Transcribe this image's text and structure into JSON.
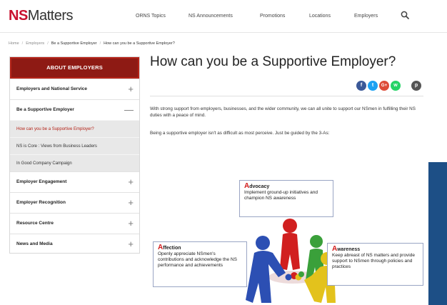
{
  "header": {
    "logo_ns": "NS",
    "logo_matters": "Matters",
    "nav": [
      "ORNS Topics",
      "NS Announcements",
      "Promotions",
      "Locations",
      "Employers"
    ]
  },
  "breadcrumb": [
    "Home",
    "Employers",
    "Be a Supportive Employer",
    "How can you be a Supportive Employer?"
  ],
  "sidebar": {
    "heading": "ABOUT EMPLOYERS",
    "items": [
      {
        "label": "Employers and National Service",
        "toggle": "+"
      },
      {
        "label": "Be a Supportive Employer",
        "toggle": "—"
      },
      {
        "label": "How can you be a Supportive Employer?"
      },
      {
        "label": "NS is Core : Views from Business Leaders"
      },
      {
        "label": "In Good Company Campaign"
      },
      {
        "label": "Employer Engagement",
        "toggle": "+"
      },
      {
        "label": "Employer Recognition",
        "toggle": "+"
      },
      {
        "label": "Resource Centre",
        "toggle": "+"
      },
      {
        "label": "News and Media",
        "toggle": "+"
      }
    ]
  },
  "main": {
    "title": "How can you be a Supportive Employer?",
    "intro": "With strong support from employers, businesses, and the wider community, we can all unite to support our NSmen in fulfilling their NS duties with a peace of mind.",
    "guide": "Being a supportive employer isn't as difficult as most perceive.  Just be guided by the 3-As:",
    "social_colors": {
      "facebook": "#3b5998",
      "twitter": "#1da1f2",
      "google": "#dd4b39",
      "whatsapp": "#25d366",
      "print": "#555555"
    },
    "social": {
      "facebook": "f",
      "twitter": "t",
      "google": "G+",
      "whatsapp": "w",
      "print": "p"
    }
  },
  "diagram": {
    "advocacy": {
      "cap": "A",
      "rest": "dvocacy",
      "text": "Implement ground-up initiatives and champion NS awareness"
    },
    "affection": {
      "cap": "A",
      "rest": "ffection",
      "text": "Openly appreciate NSmen's contributions and acknowledge the NS performance and achievements"
    },
    "awareness": {
      "cap": "A",
      "rest": "wareness",
      "text": "Keep abreast of NS matters and provide support to NSmen through policies and practices"
    },
    "figure_colors": {
      "red": "#d11f1f",
      "green": "#3aa03a",
      "blue": "#2c4fb3",
      "yellow": "#e3c21c"
    }
  },
  "colors": {
    "brand_red": "#c8102e",
    "sidebar_head": "#8e1a14",
    "side_blue_bar": "#1d4f86"
  }
}
